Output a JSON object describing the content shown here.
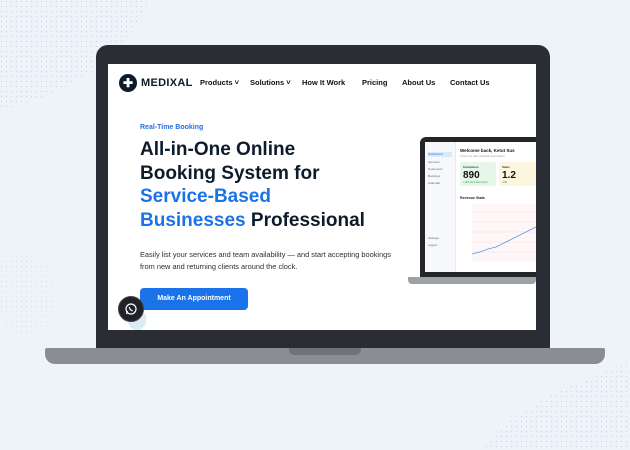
{
  "brand": {
    "name": "MEDIXAL"
  },
  "nav": {
    "items": [
      {
        "label": "Products",
        "has_dropdown": true
      },
      {
        "label": "Solutions",
        "has_dropdown": true
      },
      {
        "label": "How It Work",
        "has_dropdown": false
      },
      {
        "label": "Pricing",
        "has_dropdown": false
      },
      {
        "label": "About Us",
        "has_dropdown": false
      },
      {
        "label": "Contact Us",
        "has_dropdown": false
      }
    ],
    "dropdown_glyph": "˅"
  },
  "hero": {
    "eyebrow": "Real-Time Booking",
    "headline_line1": "All-in-One Online",
    "headline_line2": "Booking System for",
    "headline_blue1": "Service-Based",
    "headline_blue2": "Businesses",
    "headline_end": "Professional",
    "description": "Easily list your services and team availability — and start accepting bookings from new and returning clients around the clock.",
    "cta_label": "Make An Appointment"
  },
  "dashboard_preview": {
    "welcome": "Welcome back, Ketut Sus",
    "subtitle": "Track your clinic schedule and booking",
    "sidebar": [
      "Dashboard",
      "Services",
      "Customers",
      "Bookings",
      "Calendar",
      "Settings",
      "Logout"
    ],
    "stats": [
      {
        "label": "Customers",
        "value": "890",
        "trend": "+12% from last month"
      },
      {
        "label": "Sales",
        "value": "1.2",
        "trend": "+8%"
      }
    ],
    "chart_title": "Revenue Stats"
  },
  "floating": {
    "whatsapp_icon": "whatsapp-icon"
  },
  "colors": {
    "accent": "#1a73e8",
    "dark": "#0d1b2a",
    "background": "#eef3f9",
    "whatsapp": "#25d366"
  }
}
